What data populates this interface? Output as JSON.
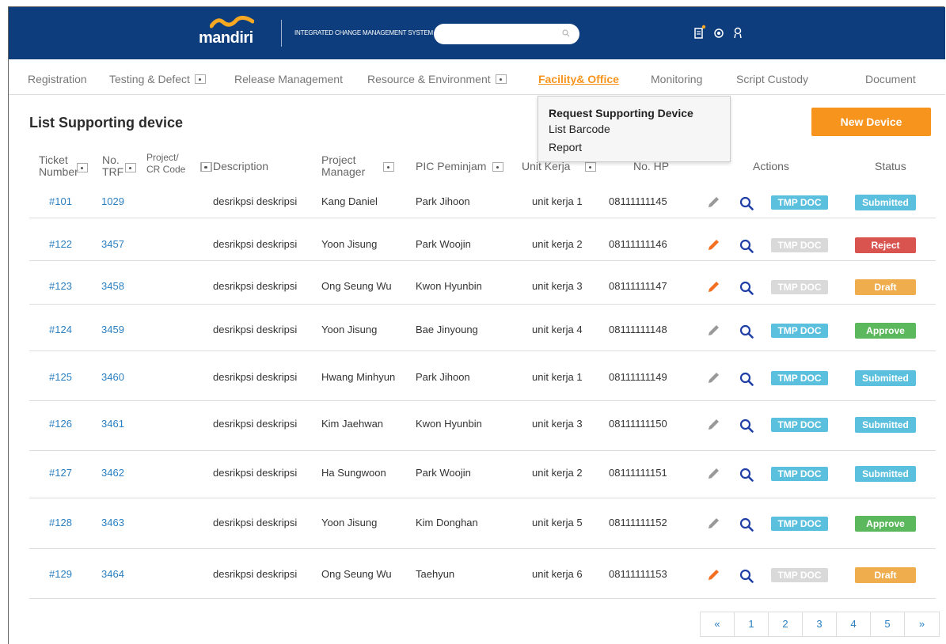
{
  "header": {
    "logo_text": "mandiri",
    "system_name": "INTEGRATED CHANGE MANAGEMENT SYSTEM",
    "search_placeholder": "",
    "icons": [
      "scanner-icon",
      "settings-icon",
      "user-icon"
    ]
  },
  "menu": [
    {
      "label": "Registration",
      "dropdown": false,
      "active": false
    },
    {
      "label": "Testing & Defect",
      "dropdown": true,
      "active": false
    },
    {
      "label": "Release Management",
      "dropdown": false,
      "active": false
    },
    {
      "label": "Resource & Environment",
      "dropdown": true,
      "active": false
    },
    {
      "label": "Facility& Office",
      "dropdown": false,
      "active": true
    },
    {
      "label": "Monitoring",
      "dropdown": false,
      "active": false
    },
    {
      "label": "Script Custody",
      "dropdown": false,
      "active": false
    },
    {
      "label": "Document",
      "dropdown": false,
      "active": false
    }
  ],
  "dropdown": {
    "items": [
      "Request Supporting Device",
      "List Barcode",
      "Report"
    ]
  },
  "page": {
    "title": "List Supporting device",
    "new_button": "New Device"
  },
  "table": {
    "columns": [
      {
        "label": "Ticket\nNumber",
        "sortable": true
      },
      {
        "label": "No.\nTRF",
        "sortable": true
      },
      {
        "label": "Project/\nCR Code",
        "sortable": true
      },
      {
        "label": "Description",
        "sortable": true
      },
      {
        "label": "Project\nManager",
        "sortable": true
      },
      {
        "label": "PIC Peminjam",
        "sortable": true
      },
      {
        "label": "Unit Kerja",
        "sortable": true
      },
      {
        "label": "No. HP",
        "sortable": false
      },
      {
        "label": "Actions",
        "sortable": false
      },
      {
        "label": "Status",
        "sortable": false
      }
    ],
    "rows": [
      {
        "ticket": "#101",
        "trf": "1029",
        "desc": "desrikpsi deskripsi",
        "pm": "Kang Daniel",
        "pic": "Park Jihoon",
        "unit": "unit kerja 1",
        "hp": "08111111145",
        "edit_active": false,
        "tmp_doc": true,
        "status": "Submitted"
      },
      {
        "ticket": "#122",
        "trf": "3457",
        "desc": "desrikpsi deskripsi",
        "pm": "Yoon Jisung",
        "pic": "Park Woojin",
        "unit": "unit kerja 2",
        "hp": "08111111146",
        "edit_active": true,
        "tmp_doc": false,
        "status": "Reject"
      },
      {
        "ticket": "#123",
        "trf": "3458",
        "desc": "desrikpsi deskripsi",
        "pm": "Ong Seung Wu",
        "pic": "Kwon Hyunbin",
        "unit": "unit kerja 3",
        "hp": "08111111147",
        "edit_active": true,
        "tmp_doc": false,
        "status": "Draft"
      },
      {
        "ticket": "#124",
        "trf": "3459",
        "desc": "desrikpsi deskripsi",
        "pm": "Yoon Jisung",
        "pic": "Bae Jinyoung",
        "unit": "unit kerja 4",
        "hp": "08111111148",
        "edit_active": false,
        "tmp_doc": true,
        "status": "Approve"
      },
      {
        "ticket": "#125",
        "trf": "3460",
        "desc": "desrikpsi deskripsi",
        "pm": "Hwang Minhyun",
        "pic": "Park Jihoon",
        "unit": "unit kerja 1",
        "hp": "08111111149",
        "edit_active": false,
        "tmp_doc": true,
        "status": "Submitted"
      },
      {
        "ticket": "#126",
        "trf": "3461",
        "desc": "desrikpsi deskripsi",
        "pm": "Kim Jaehwan",
        "pic": "Kwon Hyunbin",
        "unit": "unit kerja 3",
        "hp": "08111111150",
        "edit_active": false,
        "tmp_doc": true,
        "status": "Submitted"
      },
      {
        "ticket": "#127",
        "trf": "3462",
        "desc": "desrikpsi deskripsi",
        "pm": "Ha Sungwoon",
        "pic": "Park Woojin",
        "unit": "unit kerja 2",
        "hp": "08111111151",
        "edit_active": false,
        "tmp_doc": true,
        "status": "Submitted"
      },
      {
        "ticket": "#128",
        "trf": "3463",
        "desc": "desrikpsi deskripsi",
        "pm": "Yoon Jisung",
        "pic": "Kim Donghan",
        "unit": "unit kerja 5",
        "hp": "08111111152",
        "edit_active": false,
        "tmp_doc": true,
        "status": "Approve"
      },
      {
        "ticket": "#129",
        "trf": "3464",
        "desc": "desrikpsi deskripsi",
        "pm": "Ong Seung Wu",
        "pic": "Taehyun",
        "unit": "unit kerja 6",
        "hp": "08111111153",
        "edit_active": true,
        "tmp_doc": false,
        "status": "Draft"
      }
    ],
    "tmp_doc_label": "TMP DOC"
  },
  "status_colors": {
    "Submitted": "#5bc0de",
    "Reject": "#d9534f",
    "Draft": "#f0ad4e",
    "Approve": "#5cb85c"
  },
  "colors": {
    "header_bg": "#0d3d7c",
    "accent": "#f7941d",
    "link": "#2a7fc1",
    "edit_active": "#f36f21",
    "edit_inactive": "#999999",
    "magnifier": "#1f3fa6"
  },
  "pagination": [
    "«",
    "1",
    "2",
    "3",
    "4",
    "5",
    "»"
  ]
}
